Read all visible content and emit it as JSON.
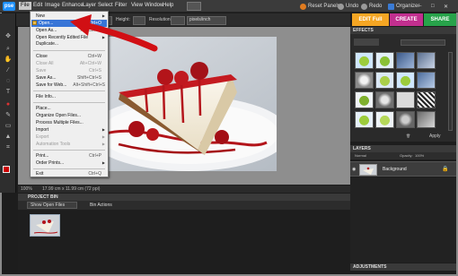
{
  "menubar": {
    "logo": "pse",
    "items": [
      "File",
      "Edit",
      "Image",
      "Enhance",
      "Layer",
      "Select",
      "Filter",
      "View",
      "Window",
      "Help"
    ],
    "reset_panels": "Reset Panels",
    "undo": "Undo",
    "redo": "Redo",
    "organizer": "Organizer"
  },
  "options": {
    "height_label": "Height:",
    "resolution_label": "Resolution:",
    "resolution_unit": "pixels/inch"
  },
  "tabs": {
    "edit_full": "EDIT Full",
    "create": "CREATE",
    "share": "SHARE",
    "colors": {
      "edit": "#f5a623",
      "create": "#c22f8f",
      "share": "#27a34a"
    }
  },
  "file_menu": {
    "items": [
      {
        "label": "New",
        "shortcut": "",
        "enabled": true,
        "submenu": true
      },
      {
        "label": "Open...",
        "shortcut": "Ctrl+O",
        "enabled": true,
        "highlighted": true
      },
      {
        "label": "Open As...",
        "shortcut": "Alt+Ctrl+O",
        "enabled": true
      },
      {
        "label": "Open Recently Edited File",
        "shortcut": "",
        "enabled": true,
        "submenu": true
      },
      {
        "label": "Duplicate...",
        "shortcut": "",
        "enabled": true
      },
      {
        "label": "Close",
        "shortcut": "Ctrl+W",
        "enabled": true
      },
      {
        "label": "Close All",
        "shortcut": "Alt+Ctrl+W",
        "enabled": false
      },
      {
        "label": "Save",
        "shortcut": "Ctrl+S",
        "enabled": false
      },
      {
        "label": "Save As...",
        "shortcut": "Shift+Ctrl+S",
        "enabled": true
      },
      {
        "label": "Save for Web...",
        "shortcut": "Alt+Shift+Ctrl+S",
        "enabled": true
      },
      {
        "label": "File Info...",
        "shortcut": "",
        "enabled": true
      },
      {
        "label": "Place...",
        "shortcut": "",
        "enabled": true
      },
      {
        "label": "Organize Open Files...",
        "shortcut": "",
        "enabled": true
      },
      {
        "label": "Process Multiple Files...",
        "shortcut": "",
        "enabled": true
      },
      {
        "label": "Import",
        "shortcut": "",
        "enabled": true,
        "submenu": true
      },
      {
        "label": "Export",
        "shortcut": "",
        "enabled": false,
        "submenu": true
      },
      {
        "label": "Automation Tools",
        "shortcut": "",
        "enabled": false,
        "submenu": true
      },
      {
        "label": "Print...",
        "shortcut": "Ctrl+P",
        "enabled": true
      },
      {
        "label": "Order Prints...",
        "shortcut": "",
        "enabled": true,
        "submenu": true
      },
      {
        "label": "Exit",
        "shortcut": "Ctrl+Q",
        "enabled": true
      }
    ]
  },
  "status": {
    "zoom": "100%",
    "doc_size": "17.99 cm x 11.99 cm (72 ppi)"
  },
  "project_bin": {
    "title": "PROJECT BIN",
    "show": "Show Open Files",
    "actions": "Bin Actions"
  },
  "effects": {
    "title": "EFFECTS",
    "apply": "Apply"
  },
  "layers": {
    "title": "LAYERS",
    "blend_mode": "Normal",
    "opacity_label": "Opacity:",
    "opacity": "100%",
    "layer_name": "Background"
  },
  "adjustments": {
    "title": "ADJUSTMENTS"
  },
  "icons": [
    "folder-icon",
    "move-tool-icon",
    "zoom-tool-icon",
    "hand-tool-icon",
    "eyedropper-icon",
    "lasso-icon",
    "brush-icon",
    "eraser-icon",
    "text-tool-icon",
    "crop-icon",
    "lock-icon",
    "trash-icon",
    "eye-icon"
  ]
}
